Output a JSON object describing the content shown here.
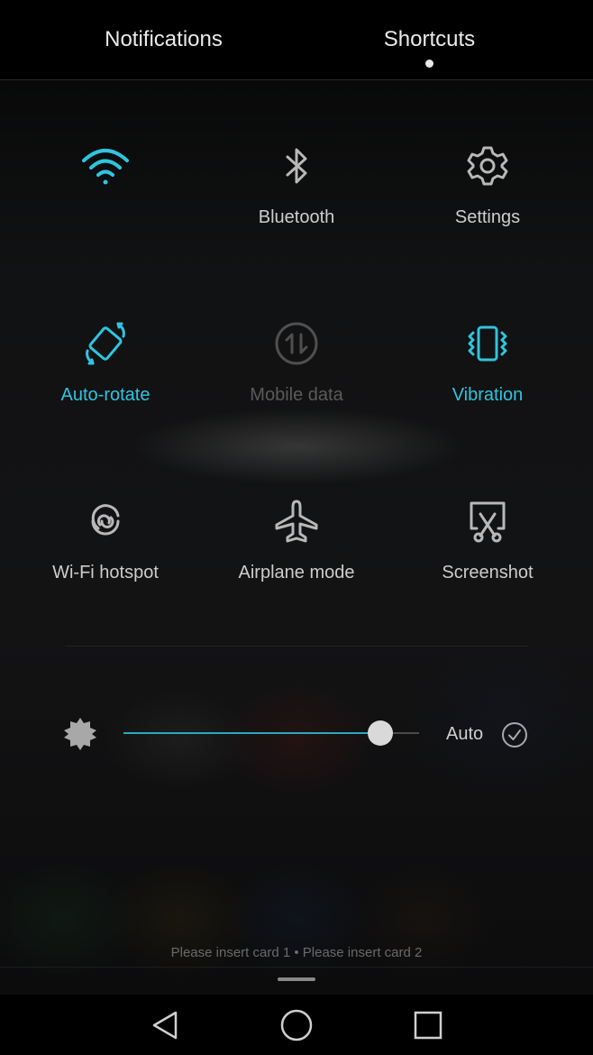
{
  "tabs": [
    {
      "label": "Notifications"
    },
    {
      "label": "Shortcuts"
    }
  ],
  "tiles": [
    {
      "label": "",
      "icon": "wifi-icon",
      "state": "active"
    },
    {
      "label": "Bluetooth",
      "icon": "bluetooth-icon",
      "state": "off"
    },
    {
      "label": "Settings",
      "icon": "gear-icon",
      "state": "off"
    },
    {
      "label": "Auto-rotate",
      "icon": "rotate-icon",
      "state": "active"
    },
    {
      "label": "Mobile data",
      "icon": "mobile-data-icon",
      "state": "disabled"
    },
    {
      "label": "Vibration",
      "icon": "vibration-icon",
      "state": "active"
    },
    {
      "label": "Wi-Fi hotspot",
      "icon": "hotspot-icon",
      "state": "off"
    },
    {
      "label": "Airplane mode",
      "icon": "airplane-icon",
      "state": "off"
    },
    {
      "label": "Screenshot",
      "icon": "screenshot-icon",
      "state": "off"
    }
  ],
  "brightness": {
    "level": 0.87,
    "auto_label": "Auto",
    "auto_checked": true
  },
  "sim_status": "Please insert card 1 • Please insert card 2",
  "colors": {
    "accent": "#2fc4e0",
    "inactive": "#b8b8b8",
    "disabled": "#4f4f4f"
  }
}
